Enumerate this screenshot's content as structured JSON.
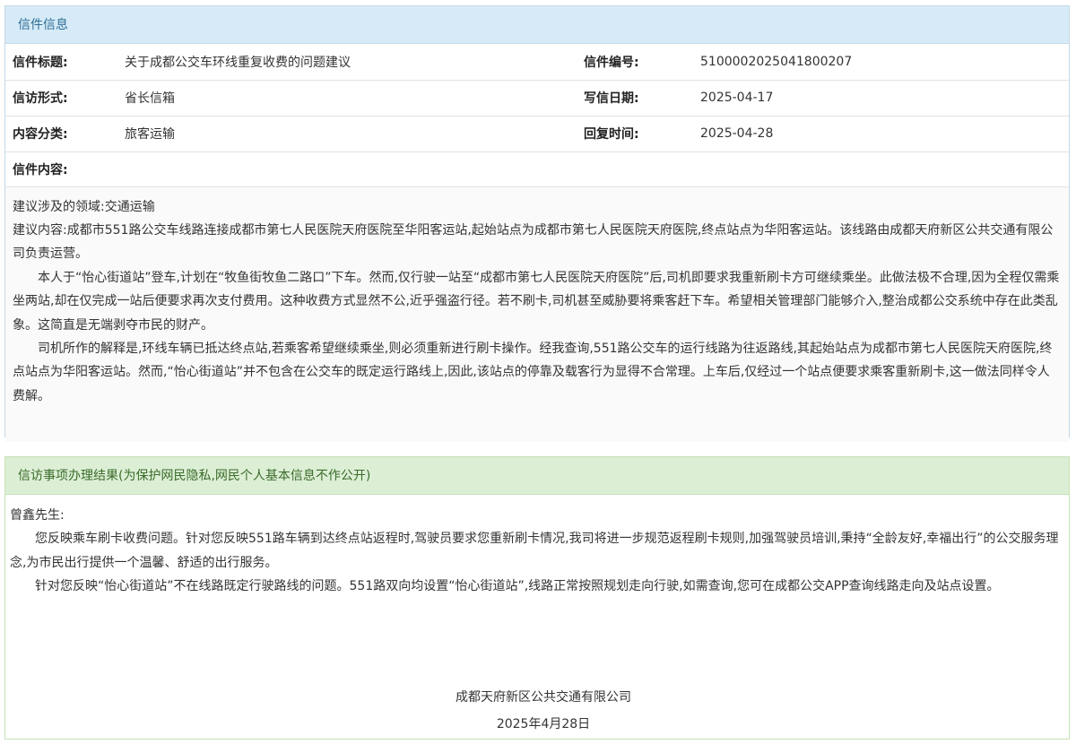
{
  "letter": {
    "header": "信件信息",
    "rows": [
      {
        "label": "信件标题:",
        "value": "关于成都公交车环线重复收费的问题建议",
        "label2": "信件编号:",
        "value2": "5100002025041800207"
      },
      {
        "label": "信访形式:",
        "value": "省长信箱",
        "label2": "写信日期:",
        "value2": "2025-04-17"
      },
      {
        "label": "内容分类:",
        "value": "旅客运输",
        "label2": "回复时间:",
        "value2": "2025-04-28"
      }
    ],
    "content_label": "信件内容:",
    "content": {
      "line1": "建议涉及的领域:交通运输",
      "line2": "建议内容:成都市551路公交车线路连接成都市第七人民医院天府医院至华阳客运站,起始站点为成都市第七人民医院天府医院,终点站点为华阳客运站。该线路由成都天府新区公共交通有限公司负责运营。",
      "para1": "本人于“怡心街道站”登车,计划在“牧鱼街牧鱼二路口”下车。然而,仅行驶一站至“成都市第七人民医院天府医院”后,司机即要求我重新刷卡方可继续乘坐。此做法极不合理,因为全程仅需乘坐两站,却在仅完成一站后便要求再次支付费用。这种收费方式显然不公,近乎强盗行径。若不刷卡,司机甚至威胁要将乘客赶下车。希望相关管理部门能够介入,整治成都公交系统中存在此类乱象。这简直是无端剥夺市民的财产。",
      "para2": "司机所作的解释是,环线车辆已抵达终点站,若乘客希望继续乘坐,则必须重新进行刷卡操作。经我查询,551路公交车的运行线路为往返路线,其起始站点为成都市第七人民医院天府医院,终点站点为华阳客运站。然而,“怡心街道站”并不包含在公交车的既定运行路线上,因此,该站点的停靠及载客行为显得不合常理。上车后,仅经过一个站点便要求乘客重新刷卡,这一做法同样令人费解。"
    }
  },
  "result": {
    "header": "信访事项办理结果(为保护网民隐私,网民个人基本信息不作公开)",
    "greeting": "曾鑫先生:",
    "para1": "您反映乘车刷卡收费问题。针对您反映551路车辆到达终点站返程时,驾驶员要求您重新刷卡情况,我司将进一步规范返程刷卡规则,加强驾驶员培训,秉持“全龄友好,幸福出行”的公交服务理念,为市民出行提供一个温馨、舒适的出行服务。",
    "para2": "针对您反映“怡心街道站”不在线路既定行驶路线的问题。551路双向均设置“怡心街道站”,线路正常按照规划走向行驶,如需查询,您可在成都公交APP查询线路走向及站点设置。",
    "org": "成都天府新区公共交通有限公司",
    "date": "2025年4月28日"
  }
}
